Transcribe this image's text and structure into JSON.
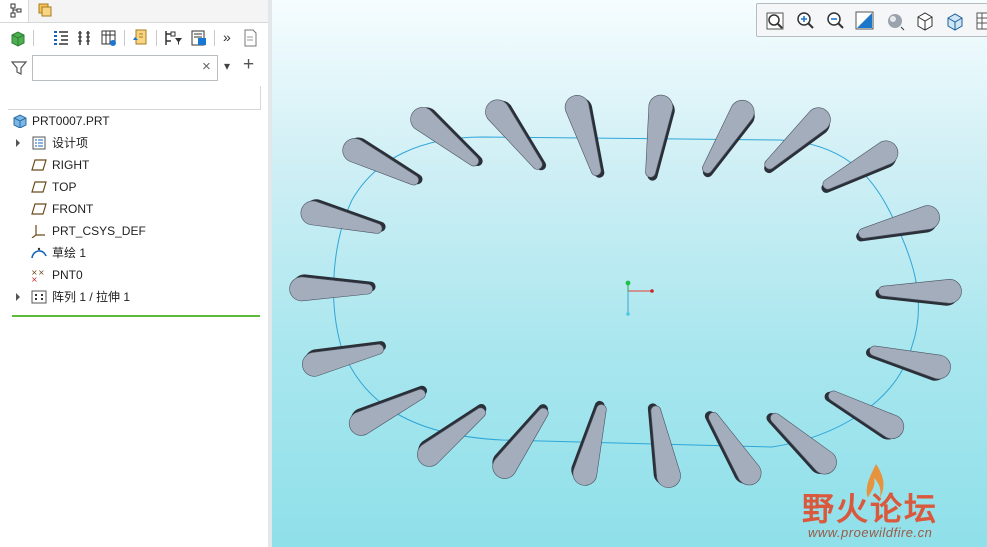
{
  "navigator": {
    "tabs": [
      {
        "name": "model-tree-tab",
        "icon": "model-tree-icon"
      },
      {
        "name": "folder-browser-tab",
        "icon": "folder-browser-icon"
      }
    ],
    "filter": {
      "value": "",
      "placeholder": "",
      "clear_glyph": "×",
      "dropdown_glyph": "▾",
      "add_glyph": "+"
    },
    "toolbar_overflow_glyph": "»"
  },
  "tree": {
    "root": {
      "label": "PRT0007.PRT",
      "icon": "part-icon"
    },
    "items": [
      {
        "label": "设计项",
        "icon": "design-items-icon",
        "expandable": true
      },
      {
        "label": "RIGHT",
        "icon": "datum-plane-icon",
        "expandable": false
      },
      {
        "label": "TOP",
        "icon": "datum-plane-icon",
        "expandable": false
      },
      {
        "label": "FRONT",
        "icon": "datum-plane-icon",
        "expandable": false
      },
      {
        "label": "PRT_CSYS_DEF",
        "icon": "csys-icon",
        "expandable": false
      },
      {
        "label": "草绘 1",
        "icon": "sketch-icon",
        "expandable": false
      },
      {
        "label": "PNT0",
        "icon": "datum-point-icon",
        "expandable": false
      },
      {
        "label": "阵列 1 / 拉伸 1",
        "icon": "pattern-icon",
        "expandable": true
      }
    ]
  },
  "view_toolbar": {
    "buttons": [
      "refit-icon",
      "zoom-in-icon",
      "zoom-out-icon",
      "repaint-icon",
      "display-style-icon",
      "saved-views-icon",
      "datum-display-icon",
      "more-icon"
    ]
  },
  "model": {
    "pattern_count": 22,
    "colors": {
      "fin_top": "#a3adbb",
      "fin_side": "#2b2f38",
      "curve": "#2fa6d8"
    }
  },
  "watermark": {
    "title": "野火论坛",
    "url": "www.proewildfire.cn"
  }
}
